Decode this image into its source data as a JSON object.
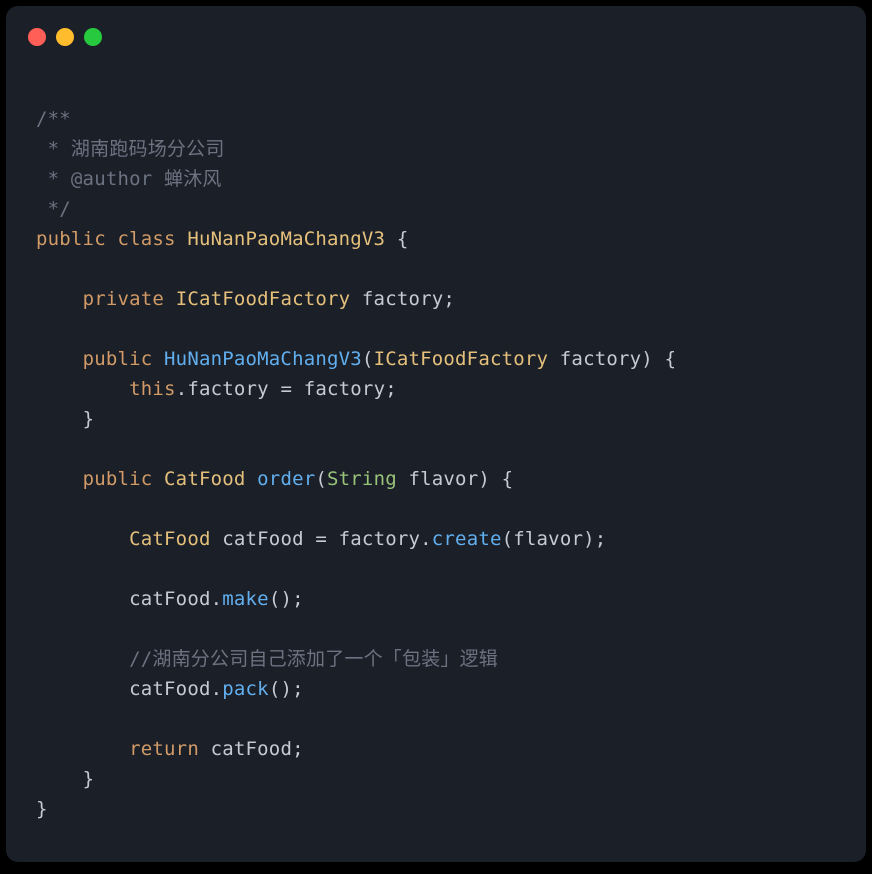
{
  "window": {
    "traffic_lights": [
      "red",
      "yellow",
      "green"
    ]
  },
  "code": {
    "c1": "/**",
    "c2": " * 湖南跑码场分公司",
    "c3": " * @author 蝉沐风",
    "c4": " */",
    "kw_public": "public",
    "kw_class": "class",
    "kw_private": "private",
    "kw_this": "this",
    "kw_return": "return",
    "class_name": "HuNanPaoMaChangV3",
    "type_ICatFoodFactory": "ICatFoodFactory",
    "type_CatFood": "CatFood",
    "type_String": "String",
    "ident_factory": "factory",
    "ident_catFood": "catFood",
    "ident_flavor": "flavor",
    "method_order": "order",
    "method_create": "create",
    "method_make": "make",
    "method_pack": "pack",
    "comment_pack": "//湖南分公司自己添加了一个「包装」逻辑",
    "brace_open": "{",
    "brace_close": "}",
    "paren_open": "(",
    "paren_close": ")",
    "semi": ";",
    "dot": ".",
    "eq": "=",
    "sp": " "
  }
}
